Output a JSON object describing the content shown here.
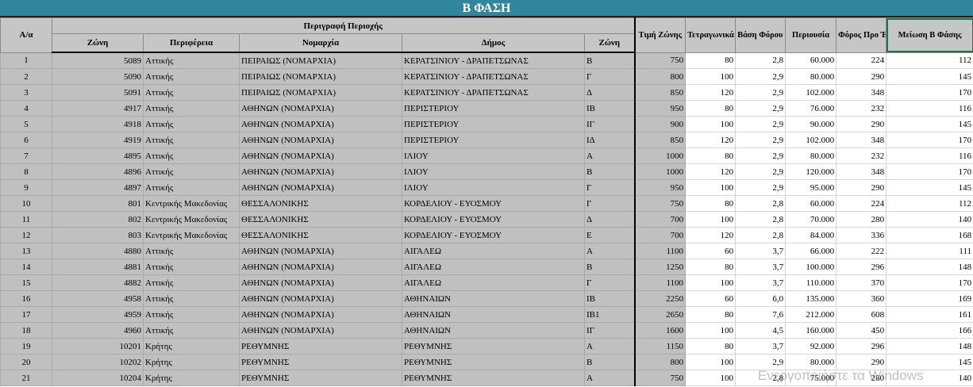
{
  "banner": "Β ΦΑΣΗ",
  "headers": {
    "aa": "Α/α",
    "perigrafi": "Περιγραφή Περιοχής",
    "zoni": "Ζώνη",
    "perifereia": "Περιφέρεια",
    "nomarxia": "Νομαρχία",
    "dimos": "Δήμος",
    "zoni2": "Ζώνη",
    "timi": "Τιμή Ζώνης",
    "tetragonika": "Τετραγωνικά Ακινήτου",
    "vasi": "Βάση Φόρου Κύριου",
    "periousia": "Περιουσία",
    "foros": "Φόρος Προ Έκπτωσης",
    "meiosi": "Μείωση Β Φάσης"
  },
  "rows": [
    {
      "aa": "1",
      "zoni": "5089",
      "perif": "Αττικής",
      "nom": "ΠΕΙΡΑΙΩΣ (ΝΟΜΑΡΧΙΑ)",
      "dimos": "ΚΕΡΑΤΣΙΝΙΟΥ - ΔΡΑΠΕΤΣΩΝΑΣ",
      "z": "Β",
      "timi": "750",
      "tm": "80",
      "vasi": "2,8",
      "per": "60.000",
      "foros": "224",
      "meiosi": "112"
    },
    {
      "aa": "2",
      "zoni": "5090",
      "perif": "Αττικής",
      "nom": "ΠΕΙΡΑΙΩΣ (ΝΟΜΑΡΧΙΑ)",
      "dimos": "ΚΕΡΑΤΣΙΝΙΟΥ - ΔΡΑΠΕΤΣΩΝΑΣ",
      "z": "Γ",
      "timi": "800",
      "tm": "100",
      "vasi": "2,9",
      "per": "80.000",
      "foros": "290",
      "meiosi": "145"
    },
    {
      "aa": "3",
      "zoni": "5091",
      "perif": "Αττικής",
      "nom": "ΠΕΙΡΑΙΩΣ (ΝΟΜΑΡΧΙΑ)",
      "dimos": "ΚΕΡΑΤΣΙΝΙΟΥ - ΔΡΑΠΕΤΣΩΝΑΣ",
      "z": "Δ",
      "timi": "850",
      "tm": "120",
      "vasi": "2,9",
      "per": "102.000",
      "foros": "348",
      "meiosi": "170"
    },
    {
      "aa": "4",
      "zoni": "4917",
      "perif": "Αττικής",
      "nom": "ΑΘΗΝΩΝ (ΝΟΜΑΡΧΙΑ)",
      "dimos": "ΠΕΡΙΣΤΕΡΙΟΥ",
      "z": "ΙΒ",
      "timi": "950",
      "tm": "80",
      "vasi": "2,9",
      "per": "76.000",
      "foros": "232",
      "meiosi": "116"
    },
    {
      "aa": "5",
      "zoni": "4918",
      "perif": "Αττικής",
      "nom": "ΑΘΗΝΩΝ (ΝΟΜΑΡΧΙΑ)",
      "dimos": "ΠΕΡΙΣΤΕΡΙΟΥ",
      "z": "ΙΓ",
      "timi": "900",
      "tm": "100",
      "vasi": "2,9",
      "per": "90.000",
      "foros": "290",
      "meiosi": "145"
    },
    {
      "aa": "6",
      "zoni": "4919",
      "perif": "Αττικής",
      "nom": "ΑΘΗΝΩΝ (ΝΟΜΑΡΧΙΑ)",
      "dimos": "ΠΕΡΙΣΤΕΡΙΟΥ",
      "z": "ΙΔ",
      "timi": "850",
      "tm": "120",
      "vasi": "2,9",
      "per": "102.000",
      "foros": "348",
      "meiosi": "170"
    },
    {
      "aa": "7",
      "zoni": "4895",
      "perif": "Αττικής",
      "nom": "ΑΘΗΝΩΝ (ΝΟΜΑΡΧΙΑ)",
      "dimos": "ΙΛΙΟΥ",
      "z": "Α",
      "timi": "1000",
      "tm": "80",
      "vasi": "2,9",
      "per": "80.000",
      "foros": "232",
      "meiosi": "116"
    },
    {
      "aa": "8",
      "zoni": "4896",
      "perif": "Αττικής",
      "nom": "ΑΘΗΝΩΝ (ΝΟΜΑΡΧΙΑ)",
      "dimos": "ΙΛΙΟΥ",
      "z": "Β",
      "timi": "1000",
      "tm": "120",
      "vasi": "2,9",
      "per": "120.000",
      "foros": "348",
      "meiosi": "170"
    },
    {
      "aa": "9",
      "zoni": "4897",
      "perif": "Αττικής",
      "nom": "ΑΘΗΝΩΝ (ΝΟΜΑΡΧΙΑ)",
      "dimos": "ΙΛΙΟΥ",
      "z": "Γ",
      "timi": "950",
      "tm": "100",
      "vasi": "2,9",
      "per": "95.000",
      "foros": "290",
      "meiosi": "145"
    },
    {
      "aa": "10",
      "zoni": "801",
      "perif": "Κεντρικής Μακεδονίας",
      "nom": "ΘΕΣΣΑΛΟΝΙΚΗΣ",
      "dimos": "ΚΟΡΔΕΛΙΟΥ - ΕΥΟΣΜΟΥ",
      "z": "Γ",
      "timi": "750",
      "tm": "80",
      "vasi": "2,8",
      "per": "60.000",
      "foros": "224",
      "meiosi": "112"
    },
    {
      "aa": "11",
      "zoni": "802",
      "perif": "Κεντρικής Μακεδονίας",
      "nom": "ΘΕΣΣΑΛΟΝΙΚΗΣ",
      "dimos": "ΚΟΡΔΕΛΙΟΥ - ΕΥΟΣΜΟΥ",
      "z": "Δ",
      "timi": "700",
      "tm": "100",
      "vasi": "2,8",
      "per": "70.000",
      "foros": "280",
      "meiosi": "140"
    },
    {
      "aa": "12",
      "zoni": "803",
      "perif": "Κεντρικής Μακεδονίας",
      "nom": "ΘΕΣΣΑΛΟΝΙΚΗΣ",
      "dimos": "ΚΟΡΔΕΛΙΟΥ - ΕΥΟΣΜΟΥ",
      "z": "Ε",
      "timi": "700",
      "tm": "120",
      "vasi": "2,8",
      "per": "84.000",
      "foros": "336",
      "meiosi": "168"
    },
    {
      "aa": "13",
      "zoni": "4880",
      "perif": "Αττικής",
      "nom": "ΑΘΗΝΩΝ (ΝΟΜΑΡΧΙΑ)",
      "dimos": "ΑΙΓΑΛΕΩ",
      "z": "Α",
      "timi": "1100",
      "tm": "60",
      "vasi": "3,7",
      "per": "66.000",
      "foros": "222",
      "meiosi": "111"
    },
    {
      "aa": "14",
      "zoni": "4881",
      "perif": "Αττικής",
      "nom": "ΑΘΗΝΩΝ (ΝΟΜΑΡΧΙΑ)",
      "dimos": "ΑΙΓΑΛΕΩ",
      "z": "Β",
      "timi": "1250",
      "tm": "80",
      "vasi": "3,7",
      "per": "100.000",
      "foros": "296",
      "meiosi": "148"
    },
    {
      "aa": "15",
      "zoni": "4882",
      "perif": "Αττικής",
      "nom": "ΑΘΗΝΩΝ (ΝΟΜΑΡΧΙΑ)",
      "dimos": "ΑΙΓΑΛΕΩ",
      "z": "Γ",
      "timi": "1100",
      "tm": "100",
      "vasi": "3,7",
      "per": "110.000",
      "foros": "370",
      "meiosi": "170"
    },
    {
      "aa": "16",
      "zoni": "4958",
      "perif": "Αττικής",
      "nom": "ΑΘΗΝΩΝ (ΝΟΜΑΡΧΙΑ)",
      "dimos": "ΑΘΗΝΑΙΩΝ",
      "z": "ΙΒ",
      "timi": "2250",
      "tm": "60",
      "vasi": "6,0",
      "per": "135.000",
      "foros": "360",
      "meiosi": "169"
    },
    {
      "aa": "17",
      "zoni": "4959",
      "perif": "Αττικής",
      "nom": "ΑΘΗΝΩΝ (ΝΟΜΑΡΧΙΑ)",
      "dimos": "ΑΘΗΝΑΙΩΝ",
      "z": "ΙΒ1",
      "timi": "2650",
      "tm": "80",
      "vasi": "7,6",
      "per": "212.000",
      "foros": "608",
      "meiosi": "161"
    },
    {
      "aa": "18",
      "zoni": "4960",
      "perif": "Αττικής",
      "nom": "ΑΘΗΝΩΝ (ΝΟΜΑΡΧΙΑ)",
      "dimos": "ΑΘΗΝΑΙΩΝ",
      "z": "ΙΓ",
      "timi": "1600",
      "tm": "100",
      "vasi": "4,5",
      "per": "160.000",
      "foros": "450",
      "meiosi": "166"
    },
    {
      "aa": "19",
      "zoni": "10201",
      "perif": "Κρήτης",
      "nom": "ΡΕΘΥΜΝΗΣ",
      "dimos": "ΡΕΘΥΜΝΗΣ",
      "z": "Α",
      "timi": "1150",
      "tm": "80",
      "vasi": "3,7",
      "per": "92.000",
      "foros": "296",
      "meiosi": "148"
    },
    {
      "aa": "20",
      "zoni": "10202",
      "perif": "Κρήτης",
      "nom": "ΡΕΘΥΜΝΗΣ",
      "dimos": "ΡΕΘΥΜΝΗΣ",
      "z": "Β",
      "timi": "800",
      "tm": "100",
      "vasi": "2,9",
      "per": "80.000",
      "foros": "290",
      "meiosi": "145"
    },
    {
      "aa": "21",
      "zoni": "10204",
      "perif": "Κρήτης",
      "nom": "ΡΕΘΥΜΝΗΣ",
      "dimos": "ΡΕΘΥΜΝΗΣ",
      "z": "Α",
      "timi": "750",
      "tm": "100",
      "vasi": "2,8",
      "per": "75.000",
      "foros": "280",
      "meiosi": "140"
    }
  ],
  "watermark": "Ενεργοποιήστε τα Windows"
}
